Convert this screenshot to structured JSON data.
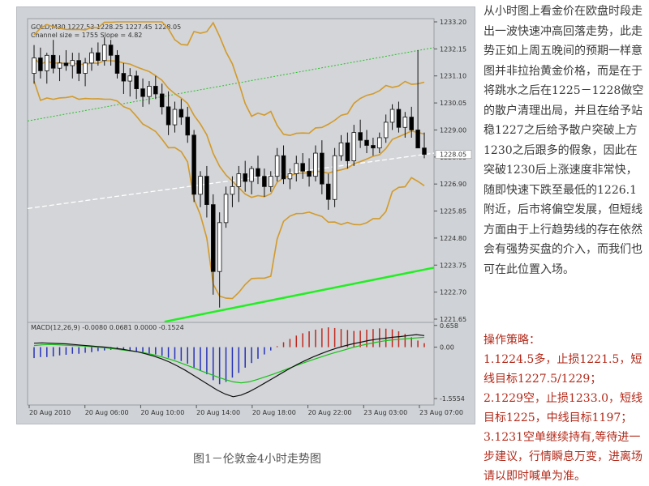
{
  "chart_data": {
    "type": "candlestick",
    "header": "GOLD,M30  1227.53 1228.25 1227.45 1228.05",
    "indicator_text": "Channel size = 1755 Slope = 4.82",
    "y_ticks": [
      "1233.20",
      "1232.15",
      "1231.10",
      "1230.05",
      "1229.00",
      "1228.05",
      "1226.90",
      "1225.85",
      "1224.80",
      "1223.75",
      "1222.70",
      "1221.65"
    ],
    "y_tick_values": [
      1233.2,
      1232.15,
      1231.1,
      1230.05,
      1229.0,
      1227.95,
      1226.9,
      1225.85,
      1224.8,
      1223.75,
      1222.7,
      1221.65
    ],
    "current_price": "1228.05",
    "current_price_value": 1228.05,
    "ylim": [
      1221.65,
      1233.2
    ],
    "x_ticks": [
      "20 Aug 2010",
      "20 Aug 06:00",
      "20 Aug 10:00",
      "20 Aug 14:00",
      "20 Aug 18:00",
      "20 Aug 22:00",
      "23 Aug 03:00",
      "23 Aug 07:00"
    ],
    "candles": [
      [
        1231.2,
        1232.3,
        1230.8,
        1231.8
      ],
      [
        1231.8,
        1232.2,
        1231.0,
        1231.3
      ],
      [
        1231.3,
        1232.0,
        1230.8,
        1231.9
      ],
      [
        1231.9,
        1232.5,
        1231.2,
        1231.4
      ],
      [
        1231.4,
        1231.9,
        1230.9,
        1231.6
      ],
      [
        1231.6,
        1232.1,
        1231.3,
        1231.5
      ],
      [
        1231.5,
        1232.0,
        1231.0,
        1231.7
      ],
      [
        1231.7,
        1232.0,
        1230.9,
        1231.2
      ],
      [
        1231.2,
        1231.8,
        1230.7,
        1231.6
      ],
      [
        1231.6,
        1232.2,
        1231.3,
        1232.0
      ],
      [
        1232.0,
        1232.4,
        1231.5,
        1231.7
      ],
      [
        1231.7,
        1232.6,
        1231.5,
        1232.3
      ],
      [
        1232.3,
        1232.5,
        1231.5,
        1231.9
      ],
      [
        1231.9,
        1232.1,
        1231.0,
        1231.2
      ],
      [
        1231.2,
        1231.6,
        1230.4,
        1230.9
      ],
      [
        1230.9,
        1231.4,
        1230.3,
        1231.1
      ],
      [
        1231.1,
        1231.3,
        1230.2,
        1230.6
      ],
      [
        1230.6,
        1231.0,
        1229.9,
        1230.3
      ],
      [
        1230.3,
        1230.9,
        1230.0,
        1230.7
      ],
      [
        1230.7,
        1231.1,
        1230.2,
        1230.4
      ],
      [
        1230.4,
        1230.8,
        1229.6,
        1229.9
      ],
      [
        1229.9,
        1230.5,
        1228.8,
        1229.2
      ],
      [
        1229.2,
        1230.1,
        1228.9,
        1229.8
      ],
      [
        1229.8,
        1230.2,
        1229.2,
        1229.5
      ],
      [
        1229.5,
        1229.9,
        1228.5,
        1228.8
      ],
      [
        1228.8,
        1229.0,
        1226.2,
        1226.5
      ],
      [
        1226.5,
        1227.4,
        1226.0,
        1227.2
      ],
      [
        1227.2,
        1227.6,
        1225.6,
        1226.1
      ],
      [
        1226.1,
        1226.5,
        1222.6,
        1223.5
      ],
      [
        1223.5,
        1225.8,
        1222.1,
        1225.4
      ],
      [
        1225.4,
        1226.8,
        1225.2,
        1226.5
      ],
      [
        1226.5,
        1227.2,
        1226.0,
        1226.8
      ],
      [
        1226.8,
        1227.6,
        1226.2,
        1227.3
      ],
      [
        1227.3,
        1227.8,
        1226.6,
        1227.0
      ],
      [
        1227.0,
        1227.6,
        1226.5,
        1227.5
      ],
      [
        1227.5,
        1228.0,
        1226.9,
        1227.2
      ],
      [
        1227.2,
        1227.5,
        1226.4,
        1226.8
      ],
      [
        1226.8,
        1227.4,
        1226.6,
        1227.2
      ],
      [
        1227.2,
        1228.3,
        1227.0,
        1228.0
      ],
      [
        1228.0,
        1228.4,
        1226.9,
        1227.1
      ],
      [
        1227.1,
        1227.5,
        1226.7,
        1227.3
      ],
      [
        1227.3,
        1228.0,
        1227.0,
        1227.7
      ],
      [
        1227.7,
        1228.1,
        1227.1,
        1227.4
      ],
      [
        1227.4,
        1227.9,
        1226.8,
        1227.2
      ],
      [
        1227.2,
        1228.4,
        1227.0,
        1228.1
      ],
      [
        1228.1,
        1228.6,
        1226.5,
        1226.9
      ],
      [
        1226.9,
        1227.3,
        1225.9,
        1226.3
      ],
      [
        1226.3,
        1228.3,
        1226.0,
        1228.0
      ],
      [
        1228.0,
        1228.8,
        1227.8,
        1228.5
      ],
      [
        1228.5,
        1228.9,
        1227.5,
        1227.8
      ],
      [
        1227.8,
        1229.2,
        1227.6,
        1228.9
      ],
      [
        1228.9,
        1229.4,
        1228.3,
        1228.6
      ],
      [
        1228.6,
        1229.0,
        1228.1,
        1228.4
      ],
      [
        1228.4,
        1228.7,
        1228.0,
        1228.3
      ],
      [
        1228.3,
        1228.9,
        1228.1,
        1228.7
      ],
      [
        1228.7,
        1229.6,
        1228.5,
        1229.3
      ],
      [
        1229.3,
        1230.0,
        1229.0,
        1229.8
      ],
      [
        1229.8,
        1230.1,
        1228.9,
        1229.1
      ],
      [
        1229.1,
        1229.7,
        1228.7,
        1229.5
      ],
      [
        1229.5,
        1229.9,
        1228.7,
        1229.0
      ],
      [
        1229.0,
        1232.1,
        1228.6,
        1228.3
      ],
      [
        1228.3,
        1228.9,
        1227.9,
        1228.05
      ]
    ],
    "macd_ticks": [
      "0.658",
      "0.00",
      "-1.5554"
    ],
    "macd_tick_values": [
      0.658,
      0.0,
      -1.5554
    ],
    "macd_label": "MACD(12,26,9) -0.0080 0.0681 0.0000 -0.1524",
    "macd_ylim": [
      -1.75,
      0.75
    ],
    "macd_hist": [
      -0.33,
      -0.3,
      -0.3,
      -0.28,
      -0.25,
      -0.23,
      -0.2,
      -0.2,
      -0.17,
      -0.15,
      -0.12,
      -0.1,
      -0.08,
      -0.06,
      -0.06,
      -0.1,
      -0.13,
      -0.17,
      -0.2,
      -0.22,
      -0.26,
      -0.32,
      -0.37,
      -0.42,
      -0.5,
      -0.62,
      -0.72,
      -0.82,
      -1.0,
      -1.12,
      -1.05,
      -0.92,
      -0.78,
      -0.62,
      -0.48,
      -0.35,
      -0.22,
      -0.1,
      0.03,
      0.15,
      0.25,
      0.35,
      0.42,
      0.48,
      0.53,
      0.57,
      0.6,
      0.58,
      0.55,
      0.52,
      0.49,
      0.5,
      0.53,
      0.55,
      0.57,
      0.56,
      0.54,
      0.48,
      0.4,
      0.3,
      0.2,
      0.12
    ],
    "macd_signal": [
      0.05,
      0.07,
      0.08,
      0.07,
      0.06,
      0.05,
      0.04,
      0.02,
      0.0,
      -0.02,
      -0.05,
      -0.08,
      -0.11,
      -0.14,
      -0.18,
      -0.23,
      -0.29,
      -0.36,
      -0.44,
      -0.53,
      -0.62,
      -0.72,
      -0.81,
      -0.9,
      -0.98,
      -1.05,
      -1.08,
      -1.05,
      -0.98,
      -0.9,
      -0.82,
      -0.73,
      -0.64,
      -0.55,
      -0.46,
      -0.38,
      -0.3,
      -0.22,
      -0.15,
      -0.08,
      -0.01,
      0.05,
      0.1,
      0.15,
      0.19,
      0.22,
      0.24,
      0.26,
      0.28,
      0.3
    ],
    "macd_line": [
      0.12,
      0.13,
      0.12,
      0.11,
      0.1,
      0.08,
      0.06,
      0.04,
      0.02,
      0.0,
      -0.03,
      -0.06,
      -0.1,
      -0.14,
      -0.2,
      -0.27,
      -0.35,
      -0.45,
      -0.57,
      -0.7,
      -0.85,
      -1.0,
      -1.15,
      -1.3,
      -1.42,
      -1.5,
      -1.45,
      -1.35,
      -1.22,
      -1.08,
      -0.94,
      -0.8,
      -0.66,
      -0.53,
      -0.41,
      -0.3,
      -0.2,
      -0.11,
      -0.03,
      0.04,
      0.1,
      0.15,
      0.2,
      0.24,
      0.27,
      0.3,
      0.32,
      0.35,
      0.38,
      0.35
    ]
  },
  "caption": "图1－伦敦金4小时走势图",
  "side_text": "从小时图上看金价在欧盘时段走出一波快速冲高回落走势，此走势正如上周五晚间的预期一样意图并非拉抬黄金价格，而是在于将跳水之后在1225－1228做空的散户清理出局，并且在给予站稳1227之后给予散户突破上方1230之后跟多的假象，因此在突破1230后上涨速度非常快，随即快速下跌至最低的1226.1附近，后市将偏空发展，但短线方面由于上行趋势线的存在依然会有强势买盘的介入，而我们也可在此位置入场。",
  "strategy": {
    "title": "操作策略：",
    "items": [
      "1.1224.5多，止损1221.5，短线目标1227.5/1229；",
      "2.1229空，止损1233.0，短线目标1225，中线目标1197；",
      "3.1231空单继续持有,等待进一步建议，行情瞬息万变，进离场请以即时喊单为准。"
    ]
  },
  "colors": {
    "chart_bg": "#d3d5d8",
    "band": "#d39a2a",
    "trend": "#22ee22",
    "dash_green": "#2bbf2b",
    "hist_pos": "#c0281f",
    "hist_neg": "#2631b8",
    "macd_signal": "#16c216",
    "strategy_text": "#b22a1a"
  }
}
